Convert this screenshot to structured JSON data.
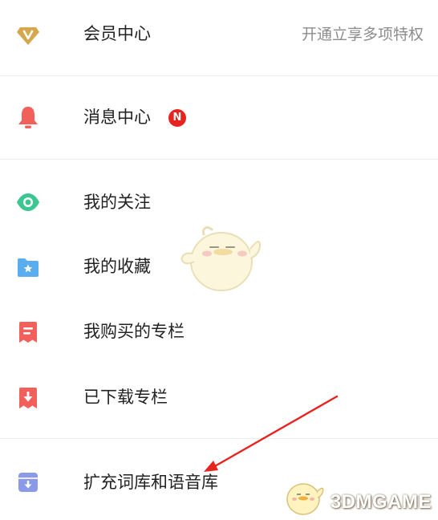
{
  "menu": {
    "vip": {
      "label": "会员中心",
      "hint": "开通立享多项特权",
      "icon": "vip-diamond-icon",
      "color": "#d6a84e"
    },
    "messages": {
      "label": "消息中心",
      "badge": "N",
      "icon": "bell-icon",
      "color": "#f2605b",
      "badge_color": "#e6231e"
    },
    "following": {
      "label": "我的关注",
      "icon": "eye-icon",
      "color": "#3cc691"
    },
    "favorites": {
      "label": "我的收藏",
      "icon": "star-folder-icon",
      "color": "#5aaef0"
    },
    "purchased": {
      "label": "我购买的专栏",
      "icon": "document-icon",
      "color": "#f2605b"
    },
    "downloaded": {
      "label": "已下载专栏",
      "icon": "download-icon",
      "color": "#f2605b"
    },
    "expand": {
      "label": "扩充词库和语音库",
      "icon": "archive-download-icon",
      "color": "#8b9ae8"
    }
  },
  "annotation": {
    "type": "red-arrow",
    "color": "#e8231e"
  },
  "watermark": {
    "text": "3DMGAME"
  }
}
